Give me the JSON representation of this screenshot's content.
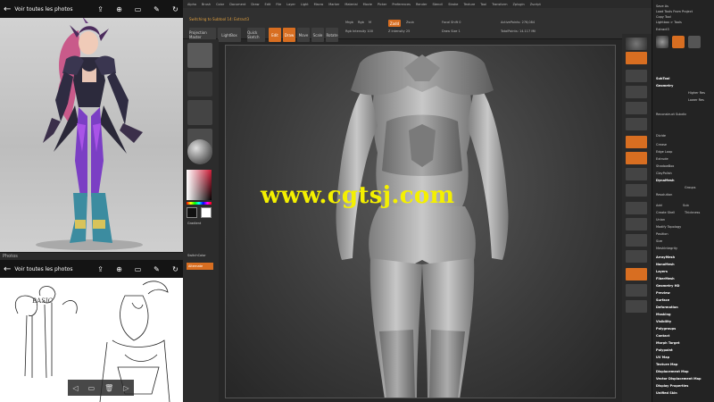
{
  "photos_top": {
    "toolbar_title": "Voir toutes les photos",
    "icons": [
      "share-icon",
      "zoom-icon",
      "slideshow-icon",
      "edit-icon",
      "rotate-icon"
    ]
  },
  "photos_bottom": {
    "caption": "Photos",
    "toolbar_title": "Voir toutes les photos",
    "sketch_label": "BASIC",
    "nav": [
      "◁",
      "▭",
      "🗑",
      "▷"
    ]
  },
  "zbrush": {
    "menu": [
      "Alpha",
      "Brush",
      "Color",
      "Document",
      "Draw",
      "Edit",
      "File",
      "Layer",
      "Light",
      "Macro",
      "Marker",
      "Material",
      "Movie",
      "Picker",
      "Preferences",
      "Render",
      "Stencil",
      "Stroke",
      "Texture",
      "Tool",
      "Transform",
      "Zplugin",
      "Zscript"
    ],
    "status": "Switching to Subtool 14: Extract3",
    "projection_master": "Projection Master",
    "lightbox": "LightBox",
    "quick_sketch": "Quick Sketch",
    "edit": "Edit",
    "draw": "Draw",
    "move": "Move",
    "scale": "Scale",
    "rotate": "Rotate",
    "mrgb": "Mrgb",
    "rgb": "Rgb",
    "m": "M",
    "zadd": "Zadd",
    "zsub": "Zsub",
    "focal_shift": "Focal Shift 0",
    "draw_size": "Draw Size 1",
    "active_points": "ActivePoints: 276,084",
    "total_points": "TotalPoints: 14.117 Mil",
    "z_intensity": "Z Intensity 25",
    "rgb_intensity": "Rgb Intensity 100",
    "gradient": "Gradient",
    "switch_color": "SwitchColor",
    "alternate": "Alternate",
    "palette": {
      "items": [
        "Save As",
        "Load Tools From Project",
        "Copy Tool",
        "Paste Tool",
        "Import",
        "Export",
        "Clone",
        "Make PolyMesh3D",
        "GoZ",
        "All",
        "Visible",
        "R",
        "Lightbox > Tools",
        "Extract3",
        "48",
        "SubTool",
        "Geometry",
        "Higher Res",
        "Lower Res",
        "Divide",
        "Reconstruct Subdiv",
        "Crease",
        "Edge Loop",
        "Extrude",
        "ShadowBox",
        "ClayPolish",
        "DynaMesh",
        "Groups",
        "Polish",
        "Blur",
        "Project",
        "Resolution",
        "Sub Projection",
        "Add",
        "Sub",
        "Create Shell",
        "Thickness",
        "Union",
        "Modify Topology",
        "Position",
        "Size",
        "MeshIntegrity",
        "ArrayMesh",
        "NanoMesh",
        "Layers",
        "FiberMesh",
        "Geometry HD",
        "Preview",
        "Surface",
        "Deformation",
        "Masking",
        "Visibility",
        "Polygroups",
        "Contact",
        "Morph Target",
        "Polypaint",
        "UV Map",
        "Texture Map",
        "Displacement Map",
        "Vector Displacement Map",
        "Display Properties",
        "Unified Skin"
      ]
    }
  },
  "watermark": "www.cgtsj.com",
  "colors": {
    "accent": "#d86e21",
    "watermark": "#f4f000",
    "ui_bg": "#262626"
  }
}
